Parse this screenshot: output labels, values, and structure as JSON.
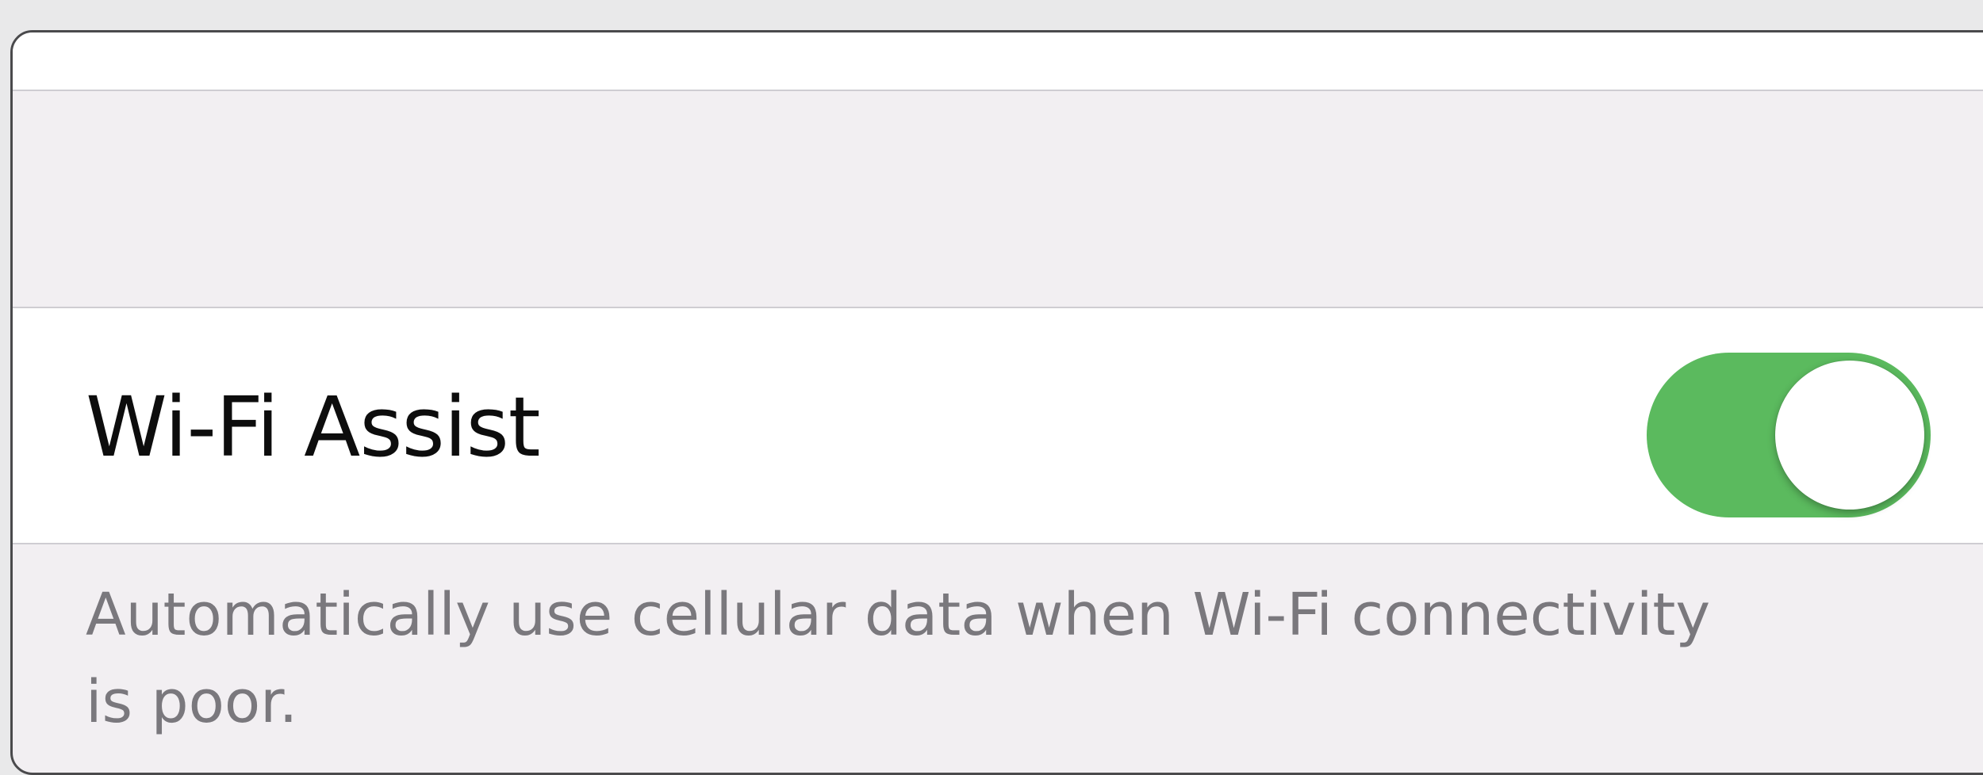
{
  "setting": {
    "label": "Wi-Fi Assist",
    "enabled": true,
    "toggle_color": "#5bba5e"
  },
  "footer": {
    "line1": "Automatically use cellular data when Wi-Fi connectivity",
    "line2": "is poor."
  }
}
